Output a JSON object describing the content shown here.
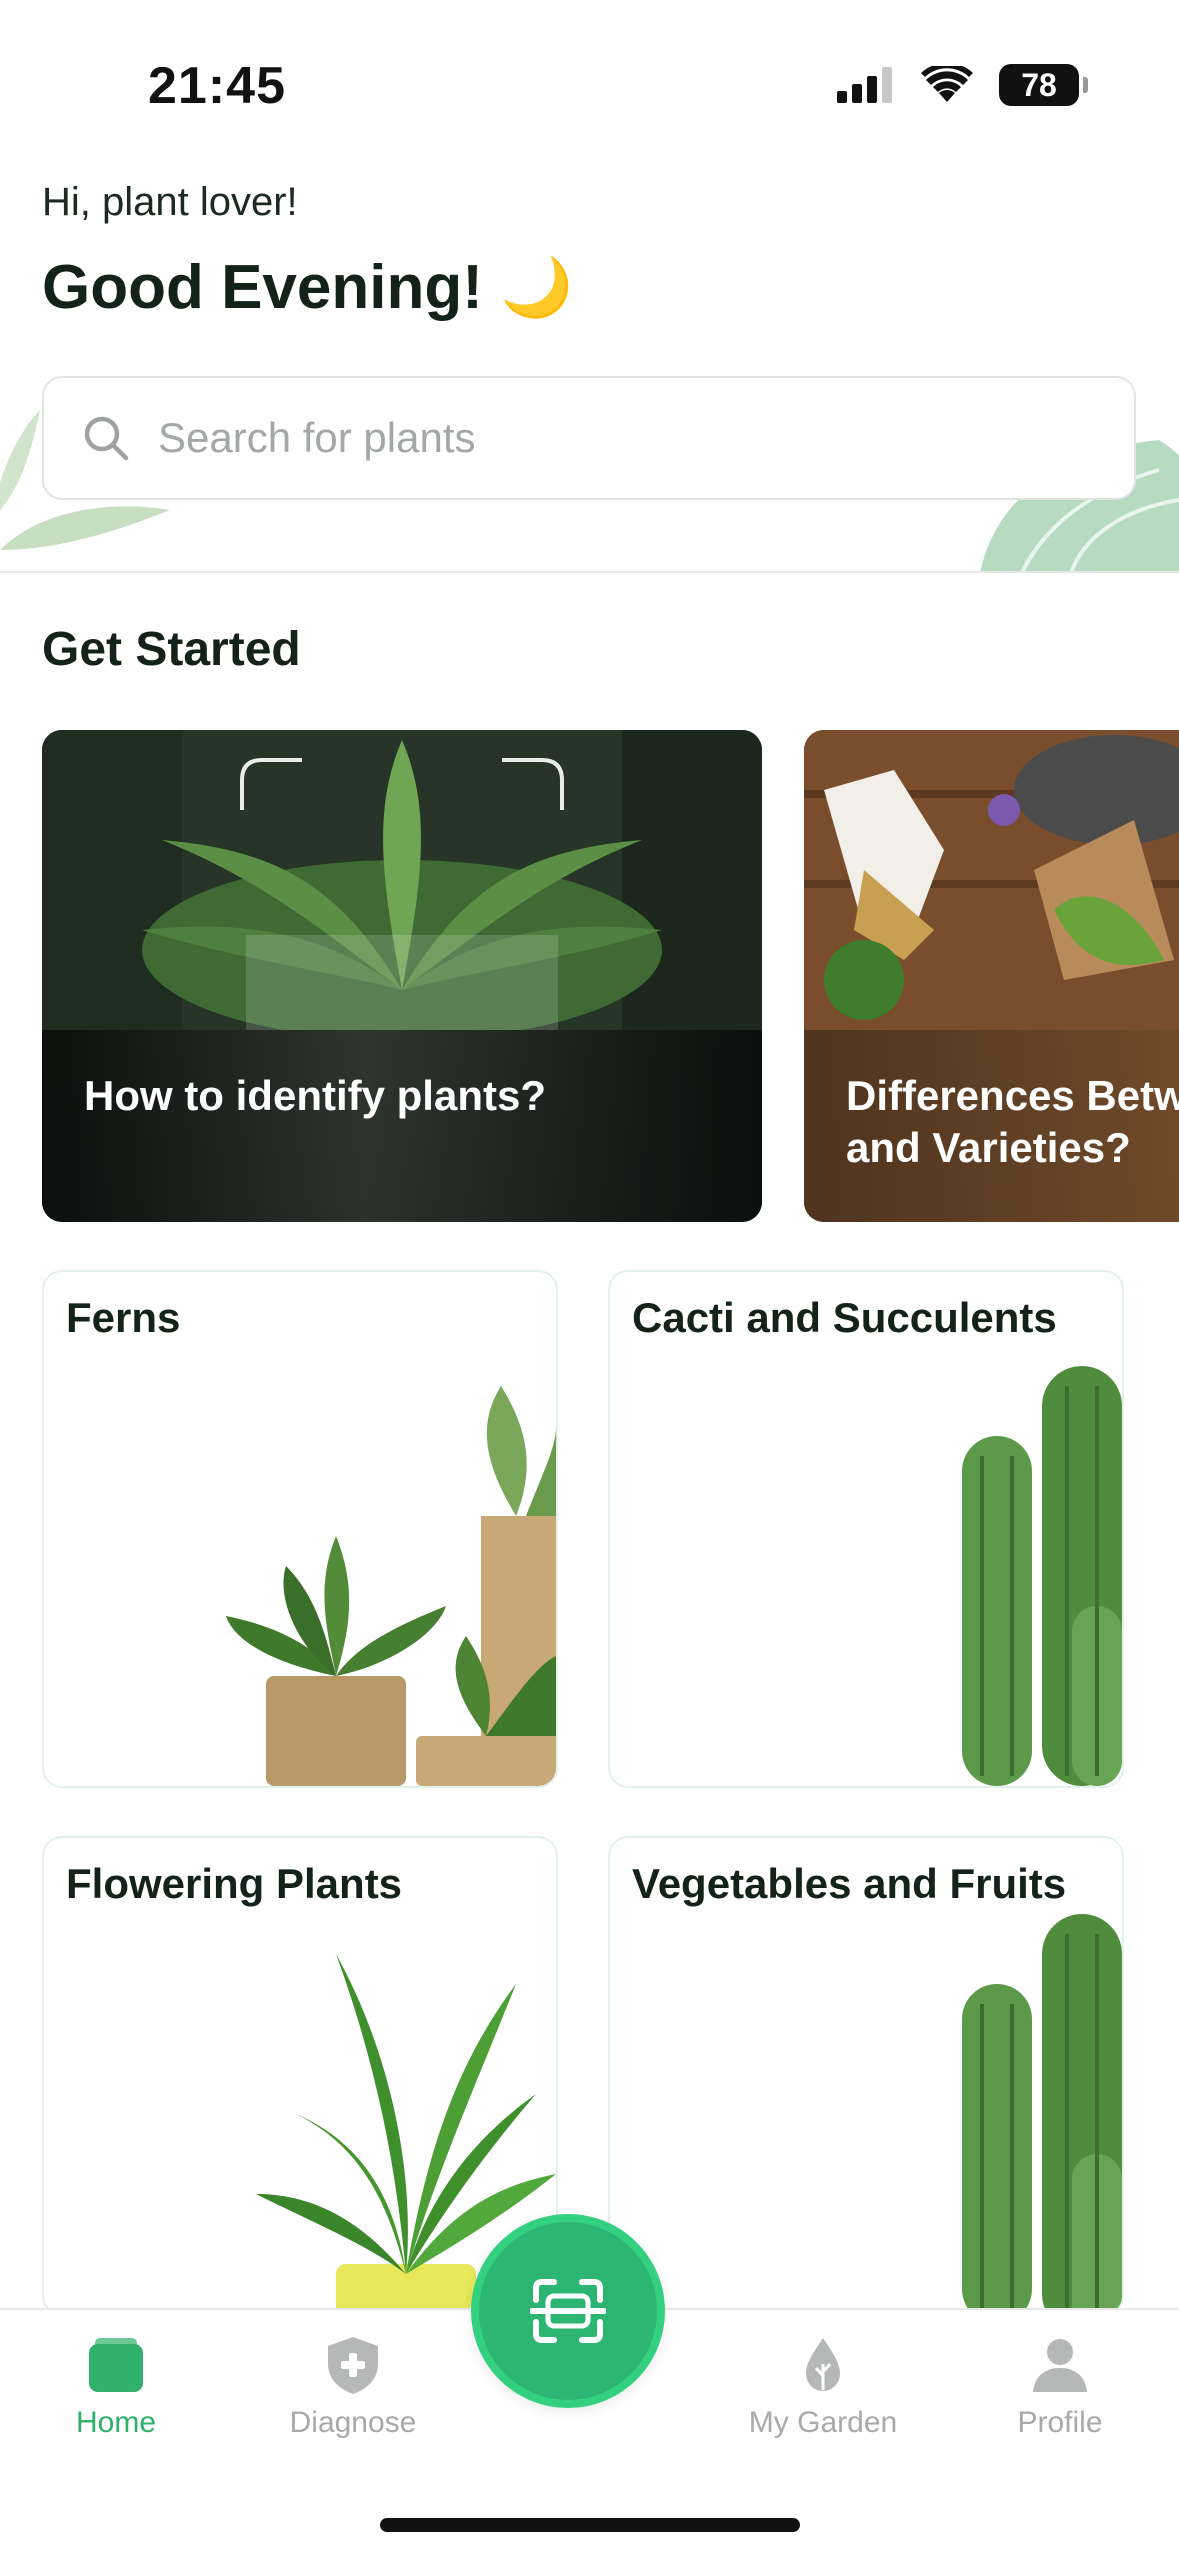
{
  "status": {
    "time": "21:45",
    "battery": "78"
  },
  "header": {
    "greeting": "Hi, plant lover!",
    "headline": "Good Evening!",
    "moon_icon": "🌙"
  },
  "search": {
    "placeholder": "Search for plants"
  },
  "get_started": {
    "title": "Get Started",
    "cards": [
      {
        "label": "How to identify plants?"
      },
      {
        "label": "Differences Betw\nand Varieties?"
      }
    ]
  },
  "categories": [
    {
      "label": "Ferns"
    },
    {
      "label": "Cacti and Succulents"
    },
    {
      "label": "Flowering Plants"
    },
    {
      "label": "Vegetables and Fruits"
    }
  ],
  "tabs": {
    "home": "Home",
    "diagnose": "Diagnose",
    "garden": "My Garden",
    "profile": "Profile"
  },
  "colors": {
    "accent": "#2fb06b",
    "inactive": "#a7aaa8",
    "text": "#13231a"
  }
}
